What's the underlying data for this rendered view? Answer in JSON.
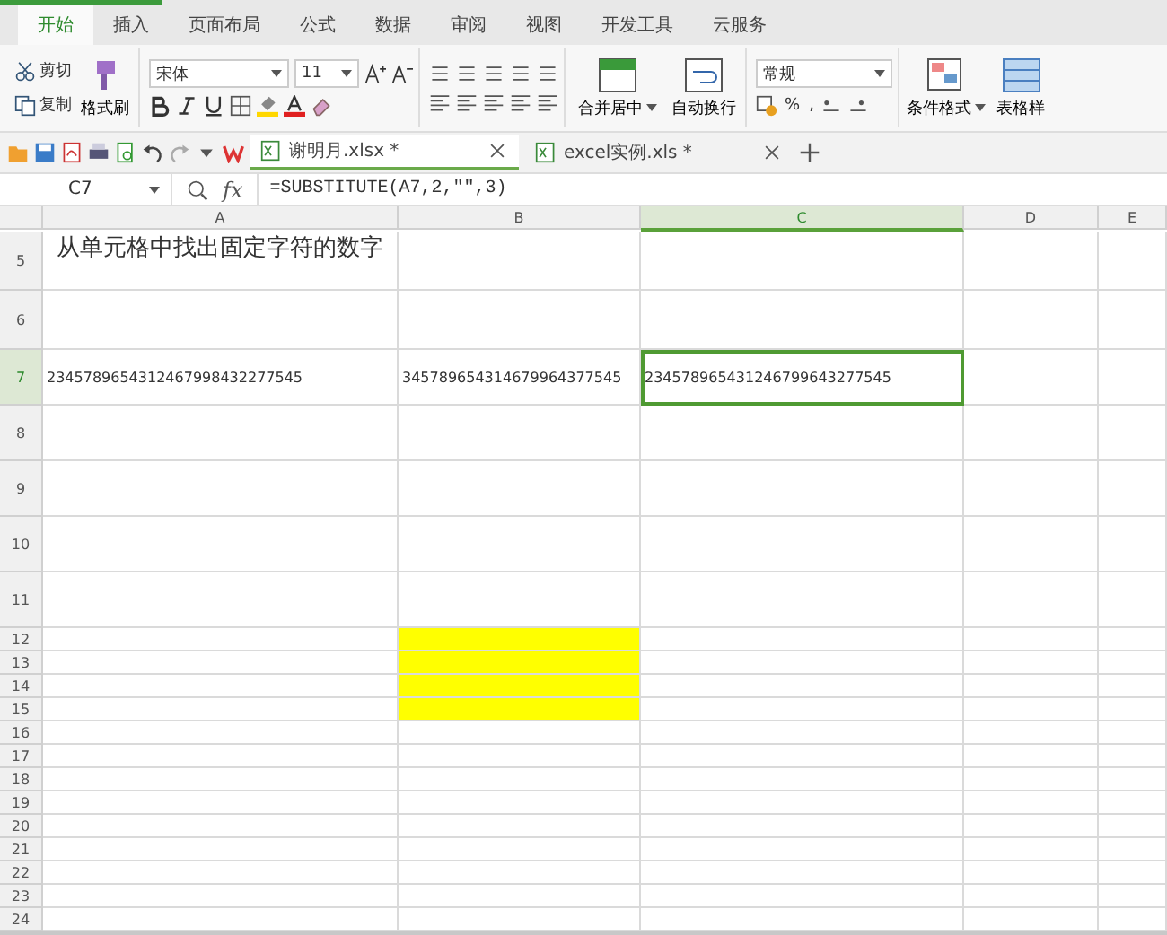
{
  "ribbon_tabs": [
    {
      "label": "开始",
      "selected": true
    },
    {
      "label": "插入",
      "selected": false
    },
    {
      "label": "页面布局",
      "selected": false
    },
    {
      "label": "公式",
      "selected": false
    },
    {
      "label": "数据",
      "selected": false
    },
    {
      "label": "审阅",
      "selected": false
    },
    {
      "label": "视图",
      "selected": false
    },
    {
      "label": "开发工具",
      "selected": false
    },
    {
      "label": "云服务",
      "selected": false
    }
  ],
  "clipboard": {
    "cut": "剪切",
    "copy": "复制",
    "format_painter": "格式刷"
  },
  "font": {
    "name": "宋体",
    "size": "11"
  },
  "alignment": {
    "merge": "合并居中",
    "wrap": "自动换行"
  },
  "number": {
    "format": "常规",
    "percent": "%",
    "comma": ","
  },
  "styles": {
    "conditional": "条件格式",
    "table": "表格样"
  },
  "documents": [
    {
      "name": "谢明月.xlsx *",
      "selected": true
    },
    {
      "name": "excel实例.xls *",
      "selected": false
    }
  ],
  "formula_bar": {
    "name_box": "C7",
    "fx": "fx",
    "formula": "=SUBSTITUTE(A7,2,\"\",3)"
  },
  "columns": [
    {
      "label": "A",
      "selected": false
    },
    {
      "label": "B",
      "selected": false
    },
    {
      "label": "C",
      "selected": true
    },
    {
      "label": "D",
      "selected": false
    },
    {
      "label": "E",
      "selected": false
    }
  ],
  "rows": [
    {
      "number": "5",
      "selected": false,
      "cells": [
        {
          "text": "从单元格中找出固定字符的数字",
          "selected": false,
          "highlighted": false
        },
        {
          "selected": false,
          "highlighted": false
        },
        {
          "selected": false,
          "highlighted": false
        },
        {
          "selected": false,
          "highlighted": false
        },
        {
          "selected": false,
          "highlighted": false
        }
      ]
    },
    {
      "number": "6",
      "selected": false
    },
    {
      "number": "7",
      "selected": true,
      "cells": [
        {
          "text": "2345789654312467998432277545",
          "selected": false,
          "highlighted": false
        },
        {
          "text": "345789654314679964377545",
          "selected": false,
          "highlighted": false
        },
        {
          "text": "234578965431246799643277545",
          "selected": true,
          "highlighted": false
        },
        {
          "selected": false,
          "highlighted": false
        },
        {
          "selected": false,
          "highlighted": false
        }
      ]
    },
    {
      "number": "8",
      "selected": false
    },
    {
      "number": "9",
      "selected": false
    },
    {
      "number": "10",
      "selected": false
    },
    {
      "number": "11",
      "selected": false
    },
    {
      "number": "12",
      "selected": false,
      "cells": [
        {
          "selected": false,
          "highlighted": false
        },
        {
          "selected": false,
          "highlighted": true
        },
        {
          "selected": false,
          "highlighted": false
        },
        {
          "selected": false,
          "highlighted": false
        },
        {
          "selected": false,
          "highlighted": false
        }
      ]
    },
    {
      "number": "13",
      "selected": false,
      "cells": [
        {
          "selected": false,
          "highlighted": false
        },
        {
          "selected": false,
          "highlighted": true
        },
        {
          "selected": false,
          "highlighted": false
        },
        {
          "selected": false,
          "highlighted": false
        },
        {
          "selected": false,
          "highlighted": false
        }
      ]
    },
    {
      "number": "14",
      "selected": false,
      "cells": [
        {
          "selected": false,
          "highlighted": false
        },
        {
          "selected": false,
          "highlighted": true
        },
        {
          "selected": false,
          "highlighted": false
        },
        {
          "selected": false,
          "highlighted": false
        },
        {
          "selected": false,
          "highlighted": false
        }
      ]
    },
    {
      "number": "15",
      "selected": false,
      "cells": [
        {
          "selected": false,
          "highlighted": false
        },
        {
          "selected": false,
          "highlighted": true
        },
        {
          "selected": false,
          "highlighted": false
        },
        {
          "selected": false,
          "highlighted": false
        },
        {
          "selected": false,
          "highlighted": false
        }
      ]
    },
    {
      "number": "16",
      "selected": false
    },
    {
      "number": "17",
      "selected": false
    },
    {
      "number": "18",
      "selected": false
    },
    {
      "number": "19",
      "selected": false
    },
    {
      "number": "20",
      "selected": false
    },
    {
      "number": "21",
      "selected": false
    },
    {
      "number": "22",
      "selected": false
    },
    {
      "number": "23",
      "selected": false
    },
    {
      "number": "24",
      "selected": false
    }
  ]
}
